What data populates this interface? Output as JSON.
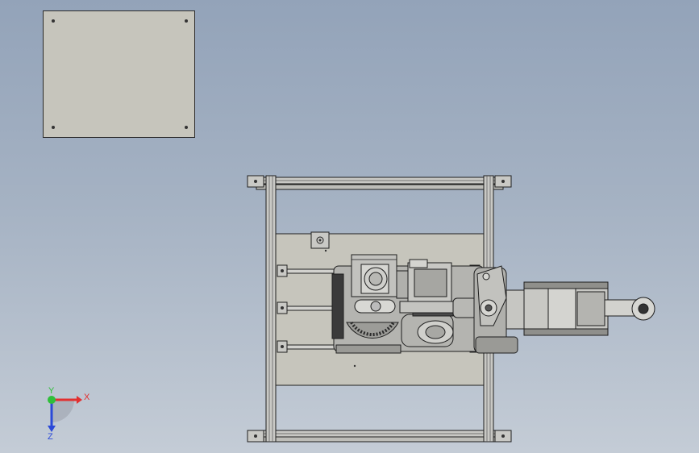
{
  "viewport": {
    "background_top": "#93a3b9",
    "background_bottom": "#c4ccd6"
  },
  "part_colors": {
    "frame_rail": "#c9c9c5",
    "plate": "#c6c5bc",
    "metal": "#b4b4b0",
    "dark": "#3a3a3a",
    "outline": "#1e1e1e"
  },
  "triad": {
    "x_label": "X",
    "y_label": "Y",
    "z_label": "Z",
    "x_color": "#e23030",
    "y_color": "#2fbf3a",
    "z_color": "#2a49d8"
  }
}
